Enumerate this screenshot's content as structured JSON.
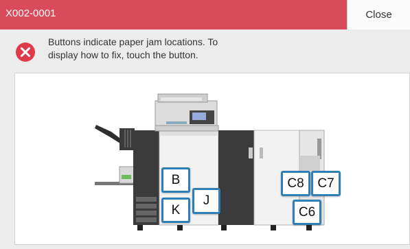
{
  "dialog": {
    "code": "X002-0001",
    "close_label": "Close",
    "message_line1": "Buttons indicate paper jam locations. To",
    "message_line2": "display how to fix, touch the button."
  },
  "jam_buttons": {
    "b": "B",
    "j": "J",
    "k": "K",
    "c8": "C8",
    "c7": "C7",
    "c6": "C6"
  },
  "colors": {
    "title_bar": "#d94a5b",
    "error_icon": "#e03a4a",
    "button_border": "#2f7fb6"
  },
  "icons": {
    "error": "error-x-circle-icon"
  }
}
